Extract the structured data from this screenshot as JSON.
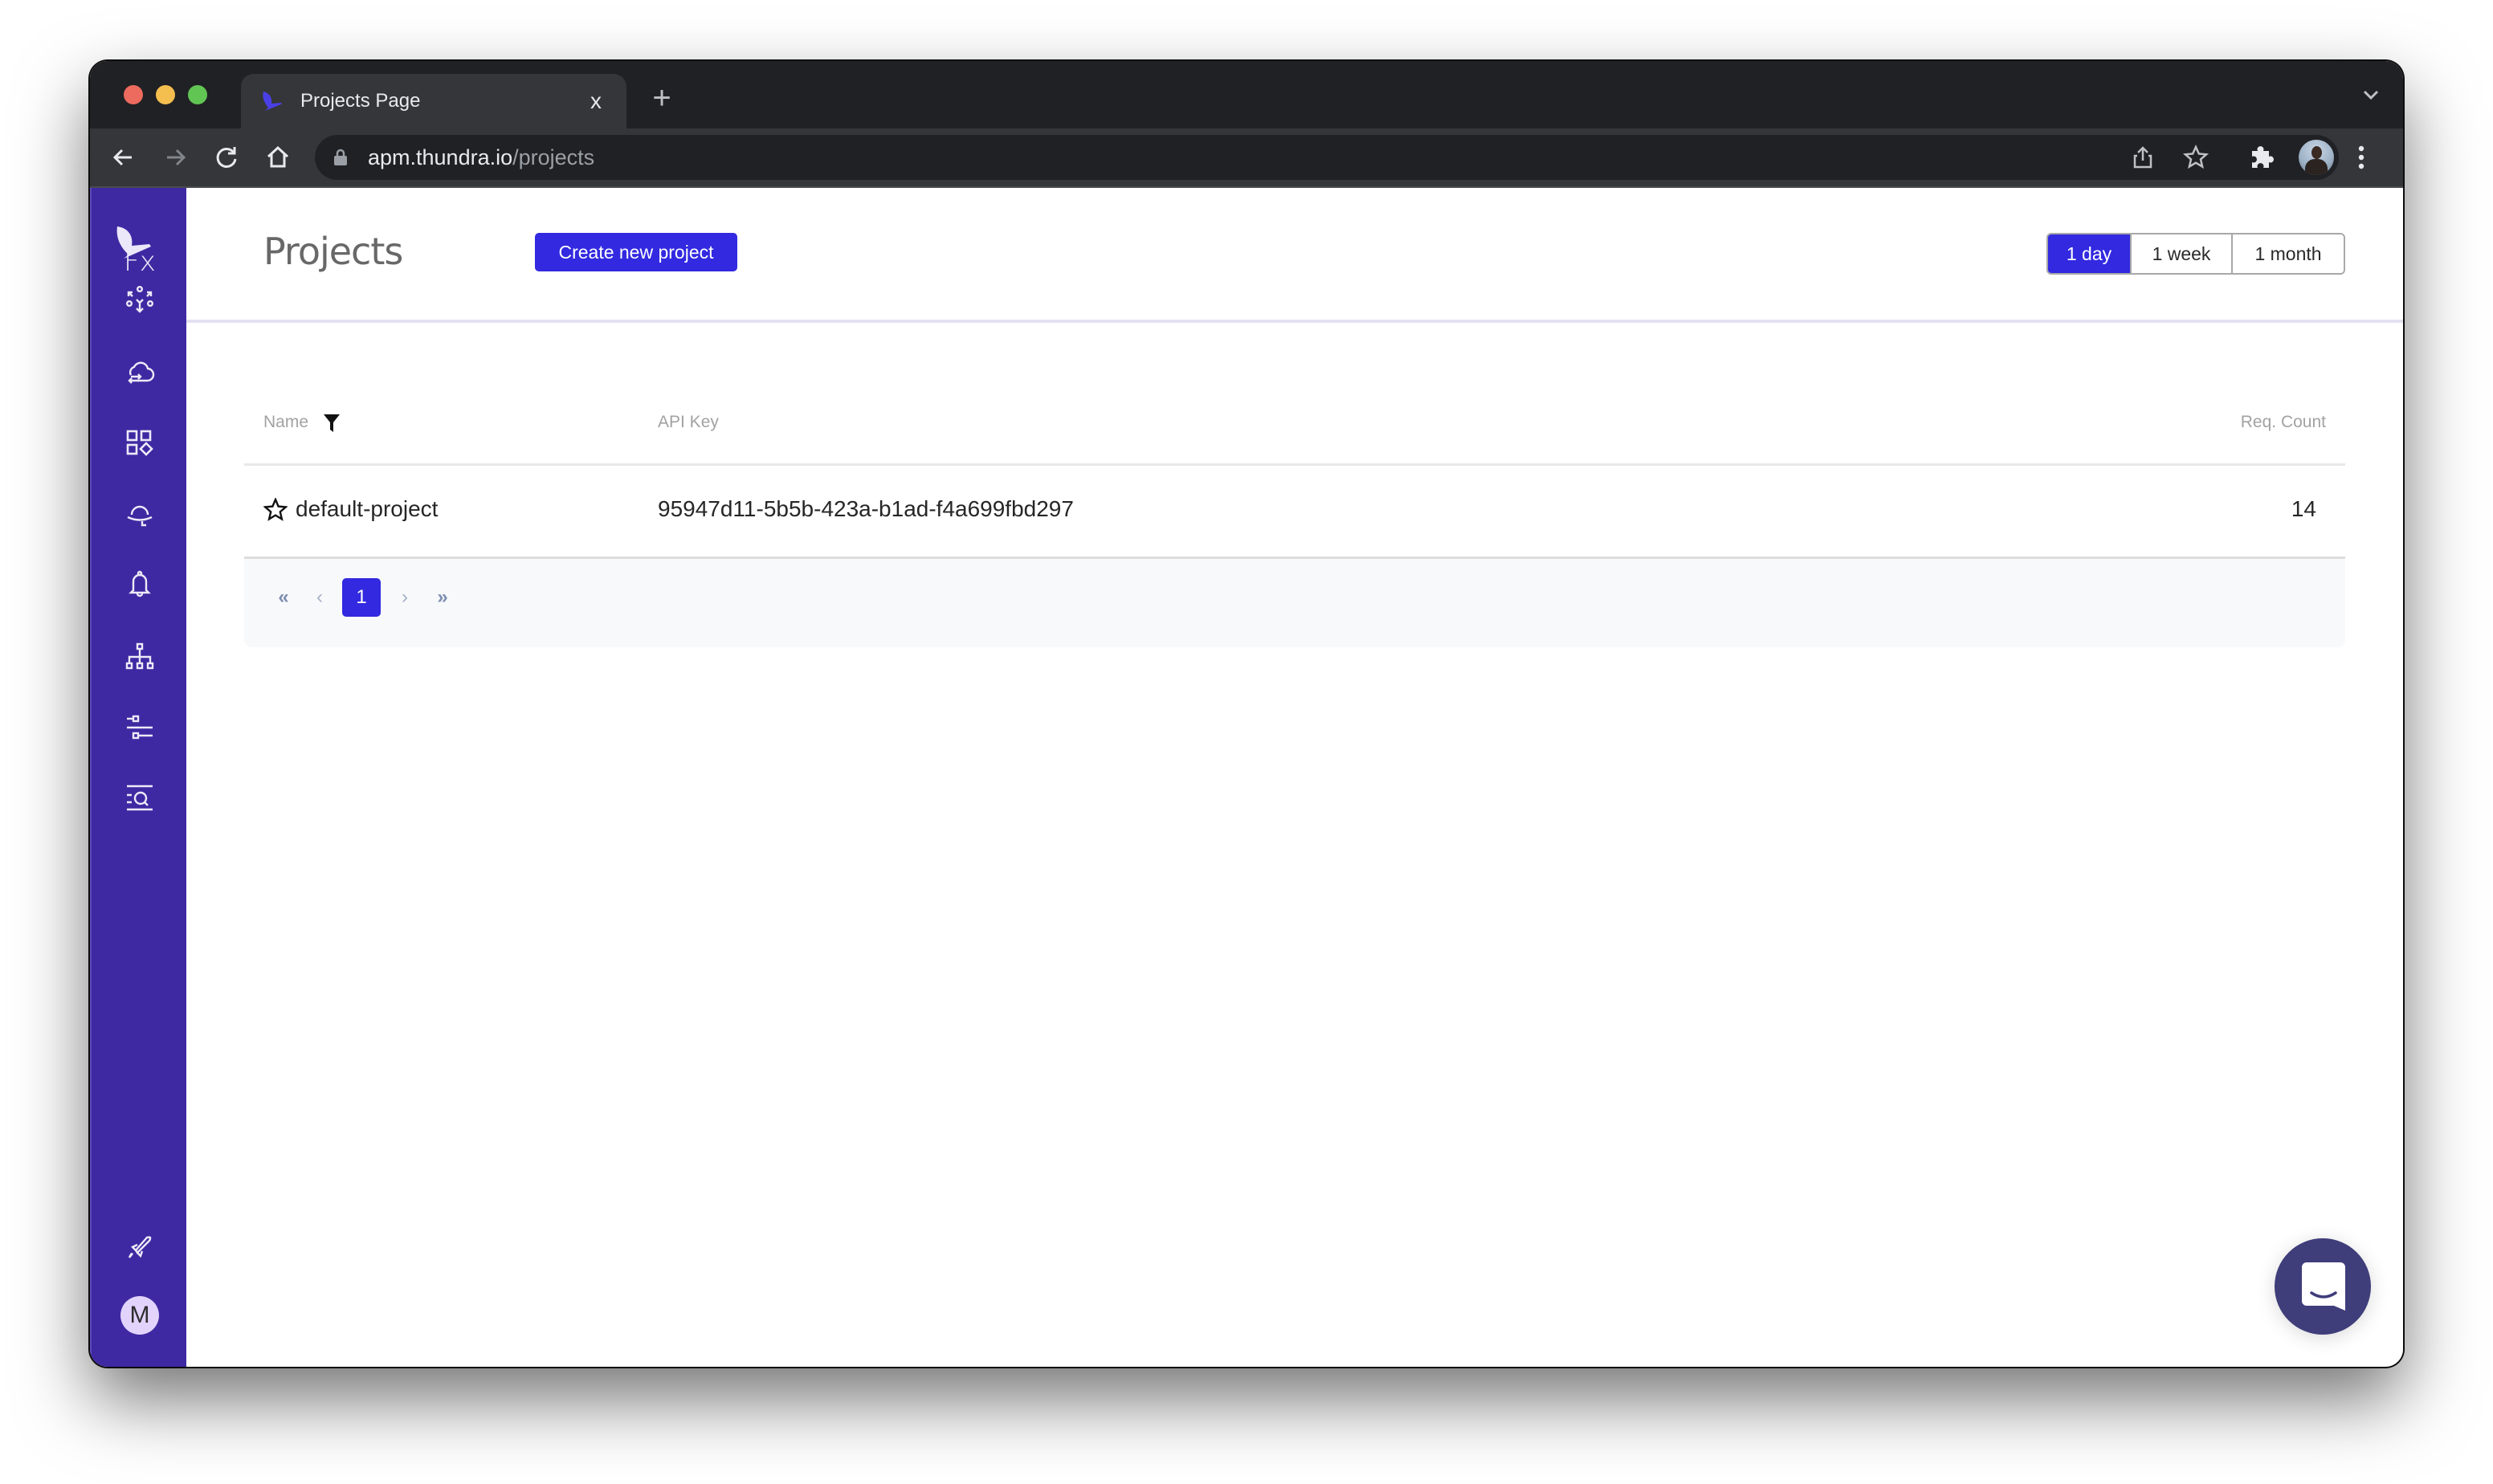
{
  "browser": {
    "tab_title": "Projects Page",
    "tab_close": "x",
    "new_tab": "+",
    "url_host": "apm.thundra.io",
    "url_path": "/projects",
    "icons": [
      "back-icon",
      "forward-icon",
      "reload-icon",
      "home-icon",
      "lock-icon",
      "share-icon",
      "bookmark-star-icon",
      "extensions-icon",
      "profile-avatar",
      "menu-kebab-icon",
      "tab-search-chevron-icon"
    ]
  },
  "sidebar": {
    "logo": "thundra-bird-logo",
    "items": [
      {
        "name": "functions",
        "label": "Fx",
        "icon": "function-icon"
      },
      {
        "name": "architecture",
        "icon": "hexagon-nodes-icon"
      },
      {
        "name": "cloud-integrations",
        "icon": "cloud-sync-icon"
      },
      {
        "name": "applications",
        "icon": "apps-grid-icon"
      },
      {
        "name": "investigations",
        "icon": "detective-hat-icon"
      },
      {
        "name": "alerts",
        "icon": "bell-icon"
      },
      {
        "name": "service-map",
        "icon": "hierarchy-icon"
      },
      {
        "name": "settings",
        "icon": "sliders-icon"
      },
      {
        "name": "search-logs",
        "icon": "list-search-icon"
      }
    ],
    "bottom": {
      "onboarding_icon": "rocket-icon",
      "avatar_letter": "M"
    }
  },
  "header": {
    "title": "Projects",
    "create_button": "Create new project",
    "time_range": {
      "options": [
        "1 day",
        "1 week",
        "1 month"
      ],
      "selected": "1 day"
    }
  },
  "table": {
    "columns": {
      "name": "Name",
      "api_key": "API Key",
      "req_count": "Req. Count"
    },
    "rows": [
      {
        "name": "default-project",
        "api_key": "95947d11-5b5b-423a-b1ad-f4a699fbd297",
        "req_count": "14",
        "starred": false
      }
    ]
  },
  "pagination": {
    "first": "«",
    "prev": "‹",
    "current_page": "1",
    "next": "›",
    "last": "»"
  },
  "colors": {
    "sidebar": "#3f29a2",
    "primary": "#3229e0",
    "chat": "#3f3d7a",
    "avatar_bg": "#e1d3fb"
  }
}
